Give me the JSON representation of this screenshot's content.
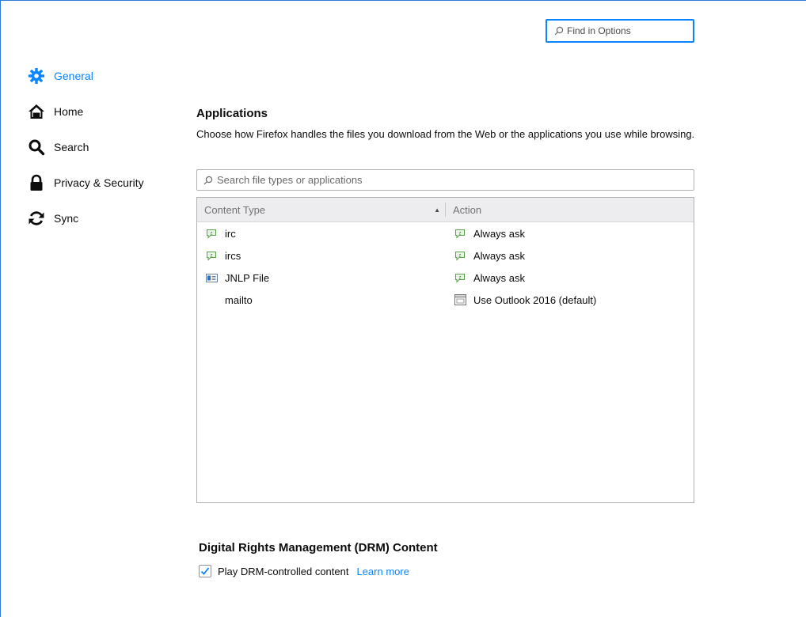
{
  "search": {
    "placeholder": "Find in Options"
  },
  "sidebar": {
    "items": [
      {
        "label": "General",
        "icon": "gear-icon",
        "selected": true
      },
      {
        "label": "Home",
        "icon": "home-icon",
        "selected": false
      },
      {
        "label": "Search",
        "icon": "search-icon",
        "selected": false
      },
      {
        "label": "Privacy & Security",
        "icon": "lock-icon",
        "selected": false
      },
      {
        "label": "Sync",
        "icon": "sync-icon",
        "selected": false
      }
    ]
  },
  "applications": {
    "heading": "Applications",
    "description": "Choose how Firefox handles the files you download from the Web or the applications you use while browsing.",
    "filter_placeholder": "Search file types or applications",
    "columns": {
      "content_type": "Content Type",
      "action": "Action"
    },
    "rows": [
      {
        "type": "irc",
        "type_icon": "chat-icon",
        "action": "Always ask",
        "action_icon": "chat-icon"
      },
      {
        "type": "ircs",
        "type_icon": "chat-icon",
        "action": "Always ask",
        "action_icon": "chat-icon"
      },
      {
        "type": "JNLP File",
        "type_icon": "jnlp-file-icon",
        "action": "Always ask",
        "action_icon": "chat-icon"
      },
      {
        "type": "mailto",
        "type_icon": "",
        "action": "Use Outlook 2016 (default)",
        "action_icon": "application-window-icon"
      }
    ]
  },
  "drm": {
    "heading": "Digital Rights Management (DRM) Content",
    "checkbox_label": "Play DRM-controlled content",
    "checked": true,
    "learn_more": "Learn more"
  },
  "colors": {
    "accent": "#0a84ff",
    "frame_border": "#2b78d8"
  }
}
